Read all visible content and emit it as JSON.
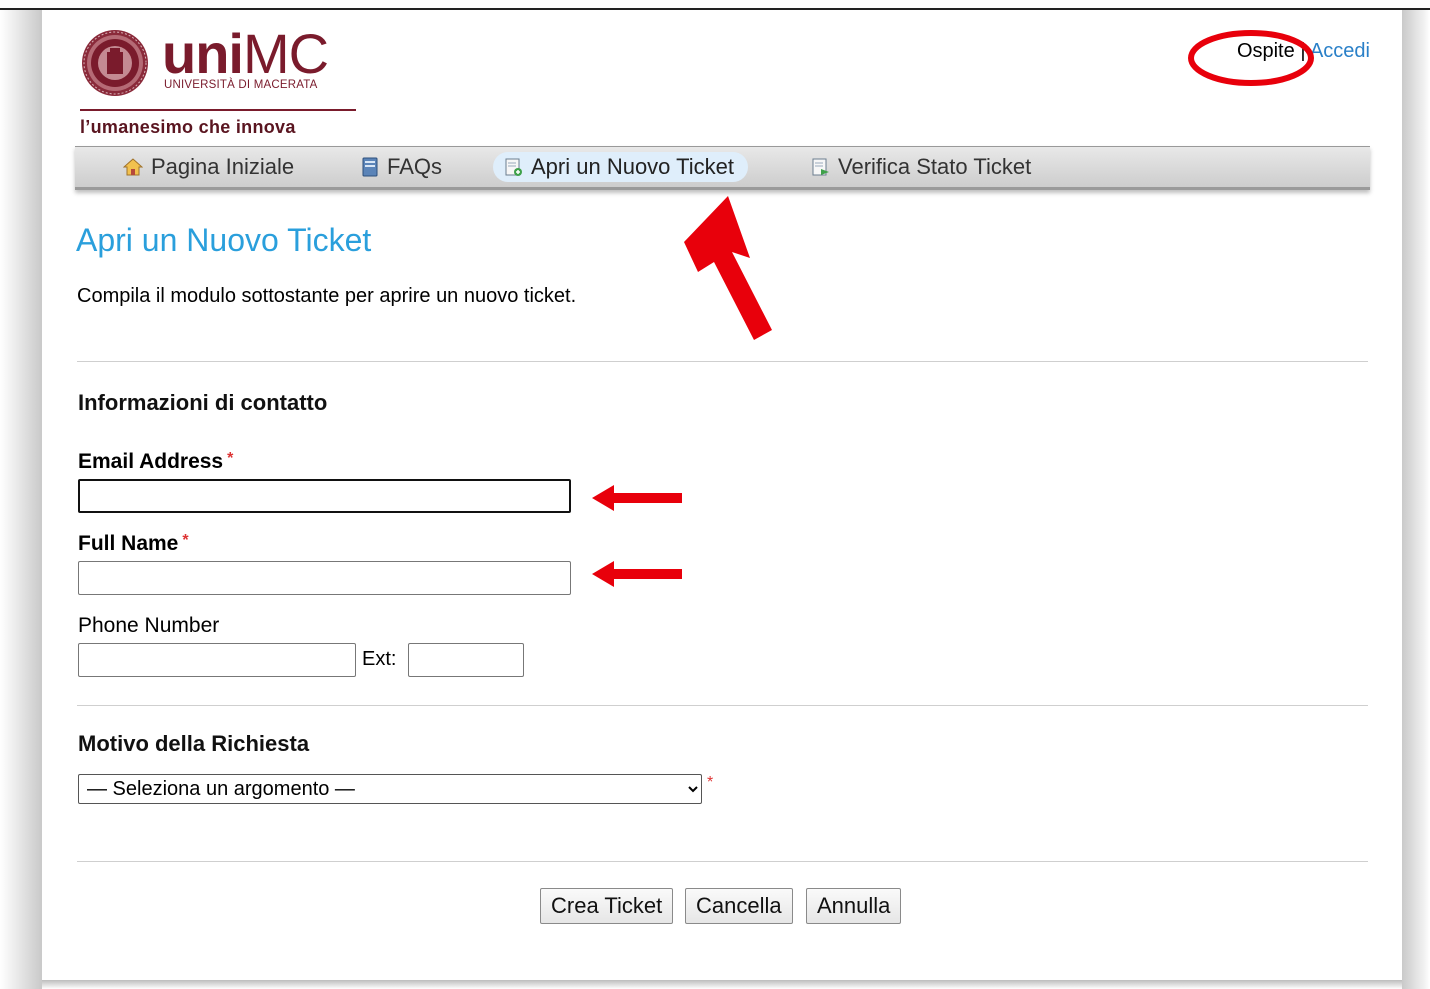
{
  "brand": {
    "wordmark_bold": "uni",
    "wordmark_light": "MC",
    "subtitle": "UNIVERSITÀ DI MACERATA",
    "tagline": "l’umanesimo che innova",
    "color": "#7a1b2c"
  },
  "user": {
    "status": "Ospite",
    "separator": "|",
    "login_link": "Accedi",
    "link_color": "#2a80c8"
  },
  "nav": {
    "items": [
      {
        "label": "Pagina Iniziale",
        "icon": "home-icon"
      },
      {
        "label": "FAQs",
        "icon": "book-icon"
      },
      {
        "label": "Apri un Nuovo Ticket",
        "icon": "new-ticket-icon",
        "active": true
      },
      {
        "label": "Verifica Stato Ticket",
        "icon": "ticket-status-icon"
      }
    ]
  },
  "page": {
    "title": "Apri un Nuovo Ticket",
    "intro": "Compila il modulo sottostante per aprire un nuovo ticket.",
    "title_color": "#2a9fdc"
  },
  "contact": {
    "heading": "Informazioni di contatto",
    "email_label": "Email Address",
    "email_value": "",
    "name_label": "Full Name",
    "name_value": "",
    "phone_label": "Phone Number",
    "phone_value": "",
    "ext_label": "Ext:",
    "ext_value": "",
    "required_mark": "*"
  },
  "reason": {
    "heading": "Motivo della Richiesta",
    "selected": "— Seleziona un argomento —",
    "required_mark": "*"
  },
  "buttons": {
    "create": "Crea Ticket",
    "reset": "Cancella",
    "cancel": "Annulla"
  },
  "annotations": {
    "color": "#e8000b"
  }
}
